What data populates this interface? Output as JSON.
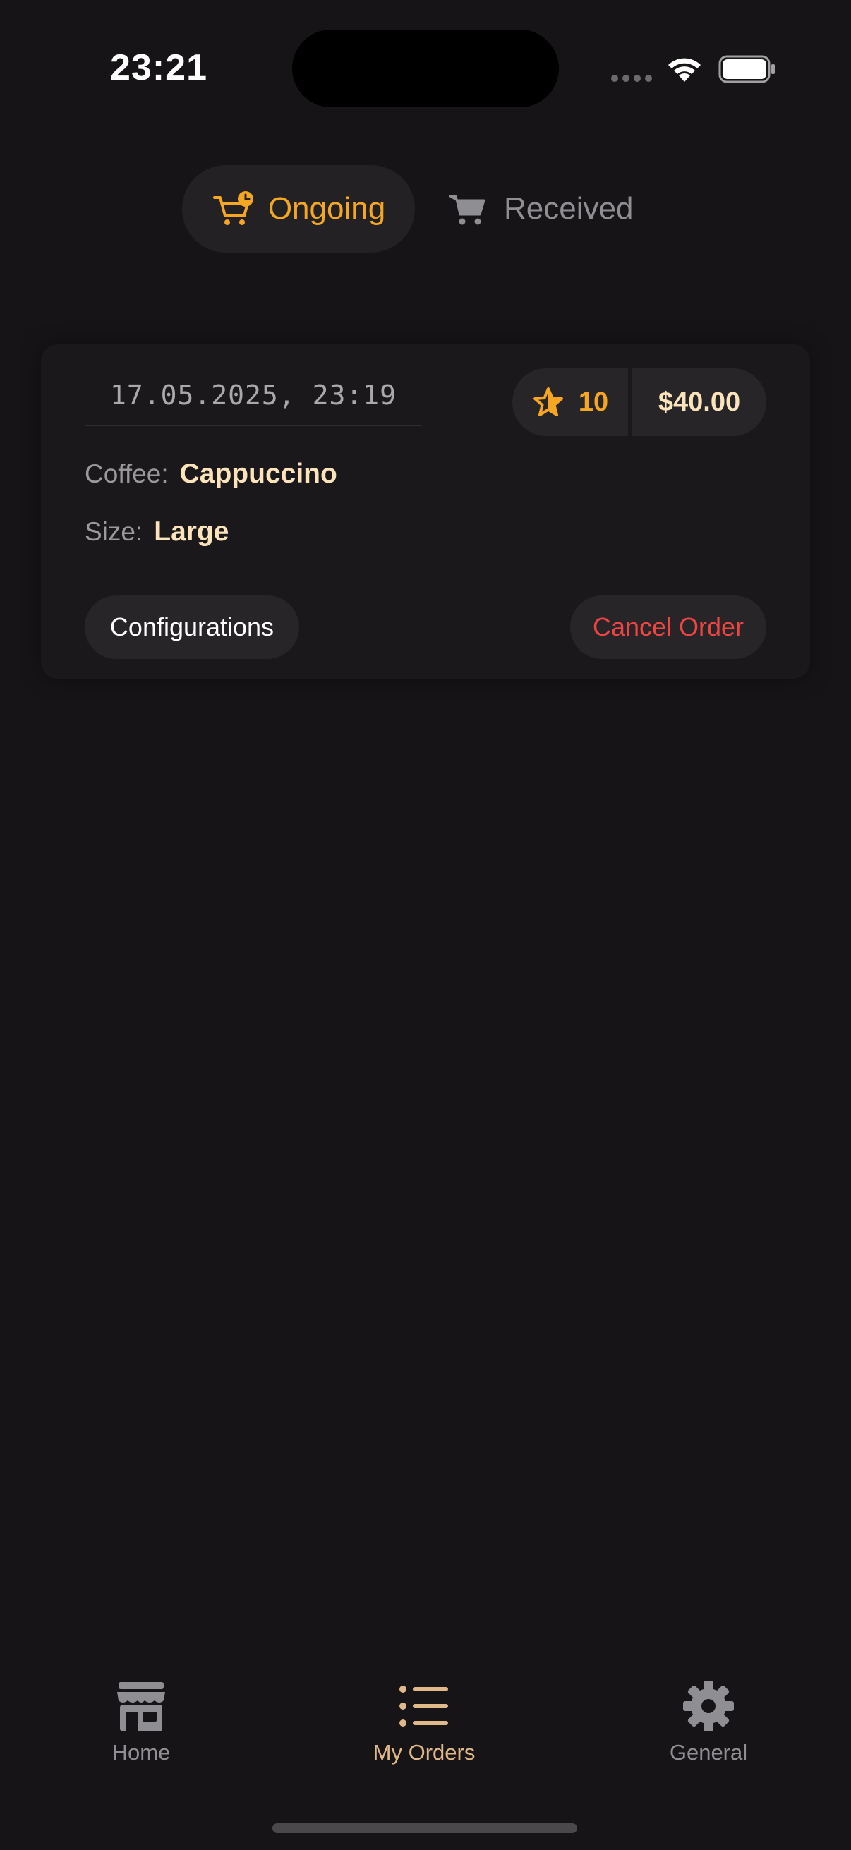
{
  "status_bar": {
    "time": "23:21"
  },
  "tabs": {
    "ongoing_label": "Ongoing",
    "received_label": "Received",
    "selected": "Ongoing"
  },
  "order": {
    "date": "17.05.2025, 23:19",
    "points": "10",
    "price": "$40.00",
    "coffee_label": "Coffee:",
    "coffee_value": "Cappuccino",
    "size_label": "Size:",
    "size_value": "Large",
    "configurations_label": "Configurations",
    "cancel_label": "Cancel Order"
  },
  "tab_bar": {
    "items": [
      {
        "label": "Home",
        "icon": "storefront-icon"
      },
      {
        "label": "My Orders",
        "icon": "list-icon"
      },
      {
        "label": "General",
        "icon": "gear-icon"
      }
    ],
    "selected": "My Orders"
  },
  "colors": {
    "background": "#161416",
    "accent_orange": "#f5a623",
    "accent_cream": "#fbe3bb",
    "danger": "#ef4444",
    "inactive": "#8e8e93"
  }
}
